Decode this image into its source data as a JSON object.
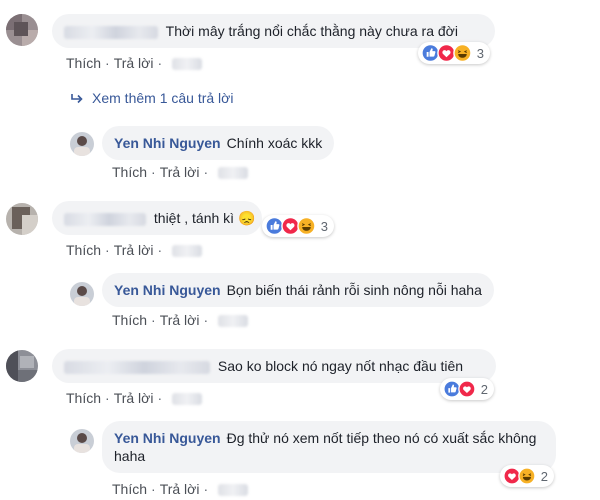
{
  "comments": [
    {
      "text": "Thời mây trắng nổi chắc thằng này chưa ra đời",
      "actions": {
        "like": "Thích",
        "reply": "Trả lời"
      },
      "reactions": {
        "types": [
          "like-icon",
          "love-icon",
          "haha-icon"
        ],
        "count": "3"
      },
      "more_replies": "Xem thêm 1 câu trả lời",
      "reply": {
        "author": "Yen Nhi Nguyen",
        "text": "Chính xoác kkk",
        "actions": {
          "like": "Thích",
          "reply": "Trả lời"
        }
      }
    },
    {
      "text": "thiệt , tánh kì 😞",
      "actions": {
        "like": "Thích",
        "reply": "Trả lời"
      },
      "reactions": {
        "types": [
          "like-icon",
          "love-icon",
          "haha-icon"
        ],
        "count": "3"
      },
      "reply": {
        "author": "Yen Nhi Nguyen",
        "text": "Bọn biến thái rảnh rỗi sinh nông nỗi haha",
        "actions": {
          "like": "Thích",
          "reply": "Trả lời"
        }
      }
    },
    {
      "text": "Sao ko block nó ngay nốt nhạc đầu tiên",
      "actions": {
        "like": "Thích",
        "reply": "Trả lời"
      },
      "reactions": {
        "types": [
          "like-icon",
          "love-icon"
        ],
        "count": "2"
      },
      "reply": {
        "author": "Yen Nhi Nguyen",
        "text": "Đg thử nó xem nốt tiếp theo nó có xuất sắc không haha",
        "actions": {
          "like": "Thích",
          "reply": "Trả lời"
        },
        "reactions": {
          "types": [
            "love-icon",
            "haha-icon"
          ],
          "count": "2"
        }
      }
    }
  ],
  "colors": {
    "link": "#385898",
    "bubble": "#f2f3f5",
    "like": "#4a7bdc",
    "love": "#f0284a",
    "haha": "#f7b125"
  }
}
